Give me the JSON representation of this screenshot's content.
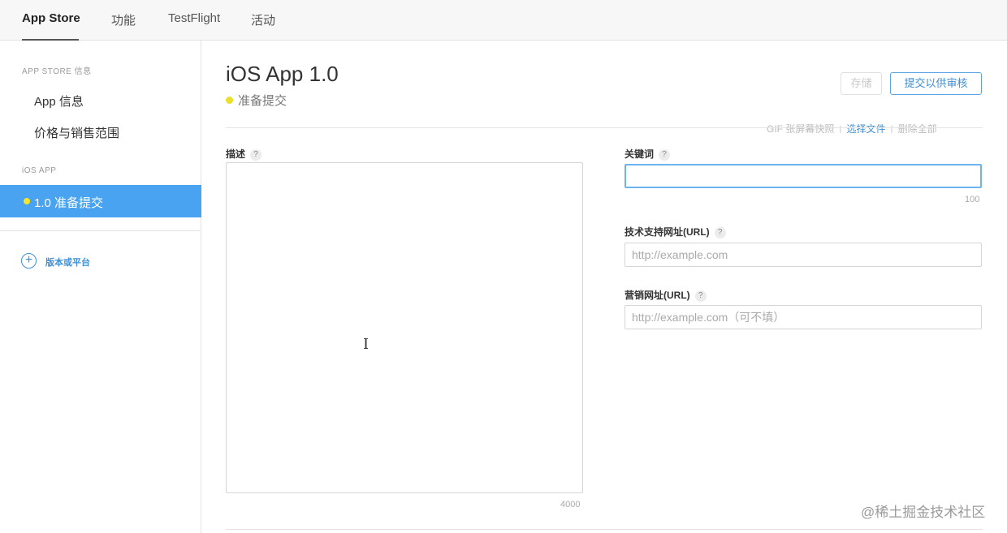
{
  "tabs": [
    {
      "label": "App Store"
    },
    {
      "label": "功能"
    },
    {
      "label": "TestFlight"
    },
    {
      "label": "活动"
    }
  ],
  "sidebar": {
    "section1_title": "APP STORE 信息",
    "items": [
      {
        "label": "App 信息"
      },
      {
        "label": "价格与销售范围"
      }
    ],
    "section2_title": "iOS APP",
    "active_version": "1.0 准备提交",
    "add_platform": "版本或平台"
  },
  "header": {
    "title": "iOS App 1.0",
    "status": "准备提交",
    "save_label": "存储",
    "submit_label": "提交以供审核"
  },
  "partial_row": {
    "text1": "GIF 张屏幕快照",
    "link1": "选择文件",
    "text2": "删除全部"
  },
  "form": {
    "description_label": "描述",
    "description_counter": "4000",
    "keywords_label": "关键词",
    "keywords_counter": "100",
    "support_url_label": "技术支持网址(URL)",
    "support_url_placeholder": "http://example.com",
    "marketing_url_label": "营销网址(URL)",
    "marketing_url_placeholder": "http://example.com（可不填）",
    "help_glyph": "?"
  },
  "watermark": "@稀土掘金技术社区",
  "colors": {
    "accent": "#4aa3f0",
    "link": "#3d8fd6",
    "status_dot": "#e9e02b"
  }
}
